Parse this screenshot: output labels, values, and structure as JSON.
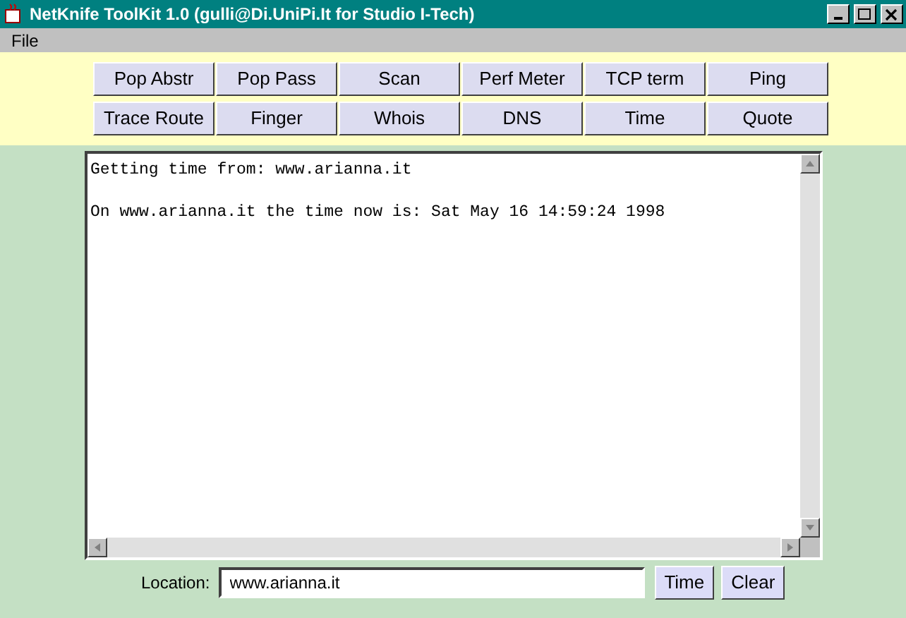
{
  "window": {
    "title": "NetKnife ToolKit 1.0 (gulli@Di.UniPi.It for Studio I-Tech)"
  },
  "menu": [
    "File"
  ],
  "tool_buttons": [
    [
      "Pop Abstr",
      "Pop Pass",
      "Scan",
      "Perf Meter",
      "TCP term",
      "Ping"
    ],
    [
      "Trace Route",
      "Finger",
      "Whois",
      "DNS",
      "Time",
      "Quote"
    ]
  ],
  "output": {
    "lines": [
      "Getting time from: www.arianna.it",
      "On www.arianna.it the time now is: Sat May 16 14:59:24 1998"
    ]
  },
  "location": {
    "label": "Location:",
    "value": "www.arianna.it"
  },
  "buttons": [
    "Time",
    "Clear"
  ]
}
